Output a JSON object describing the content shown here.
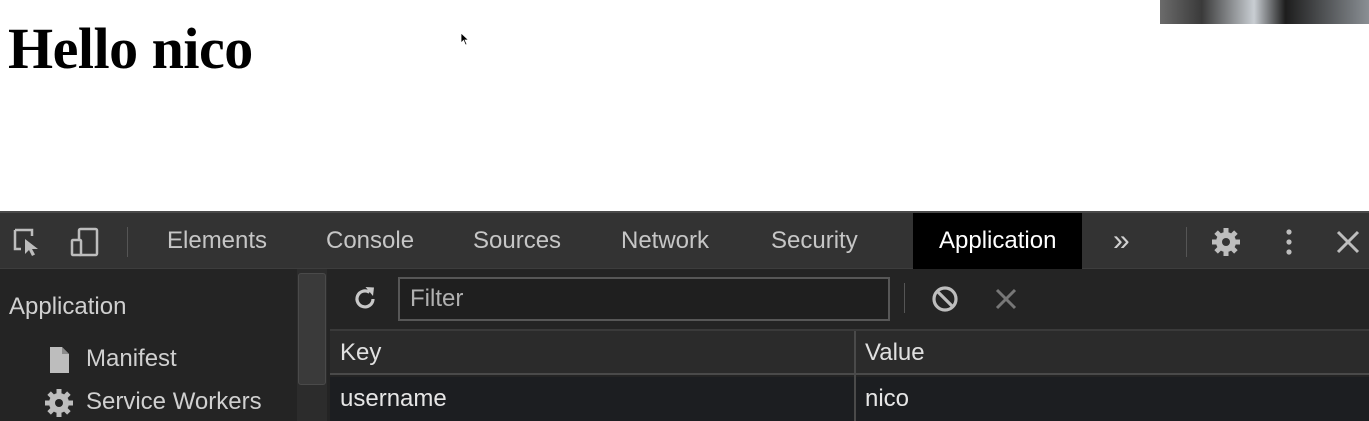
{
  "page": {
    "heading": "Hello nico"
  },
  "devtools": {
    "tabs": [
      "Elements",
      "Console",
      "Sources",
      "Network",
      "Security",
      "Application"
    ],
    "active_tab": "Application",
    "more_tabs": "»"
  },
  "sidebar": {
    "heading": "Application",
    "items": [
      {
        "label": "Manifest",
        "icon": "file-icon"
      },
      {
        "label": "Service Workers",
        "icon": "gear-icon"
      }
    ]
  },
  "storage": {
    "filter_placeholder": "Filter",
    "columns": [
      "Key",
      "Value"
    ],
    "rows": [
      {
        "key": "username",
        "value": "nico"
      }
    ]
  },
  "colors": {
    "devtools_bg": "#242424",
    "tabbar_bg": "#333333",
    "active_tab_bg": "#000000"
  }
}
